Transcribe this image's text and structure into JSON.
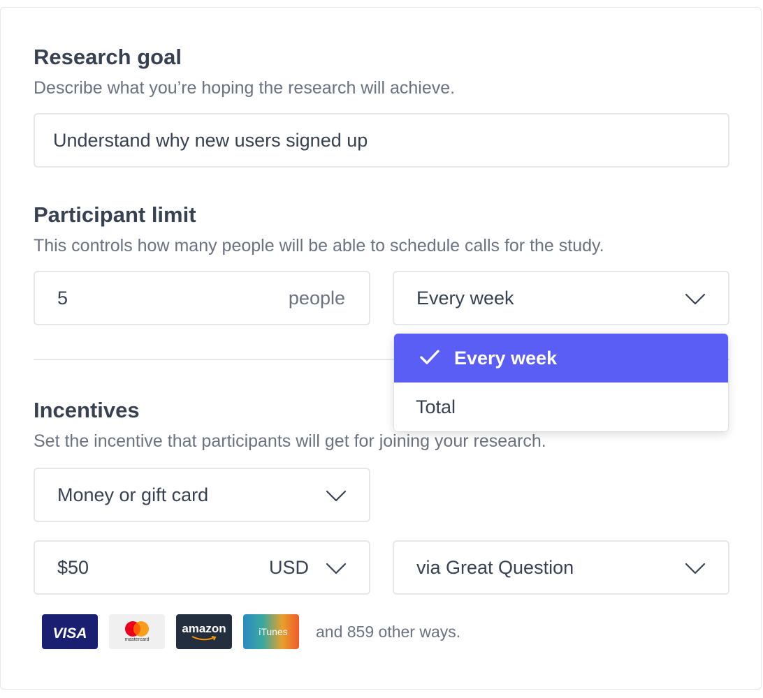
{
  "research_goal": {
    "title": "Research goal",
    "description": "Describe what you’re hoping the research will achieve.",
    "input_value": "Understand why new users signed up"
  },
  "participant_limit": {
    "title": "Participant limit",
    "description": "This controls how many people will be able to schedule calls for the study.",
    "count_value": "5",
    "count_unit": "people",
    "frequency_selected": "Every week",
    "dropdown_options": [
      {
        "label": "Every week",
        "selected": true
      },
      {
        "label": "Total",
        "selected": false
      }
    ]
  },
  "incentives": {
    "title": "Incentives",
    "description": "Set the incentive that participants will get for joining your research.",
    "type_selected": "Money or gift card",
    "amount_value": "$50",
    "currency": "USD",
    "provider_selected": "via Great Question",
    "payment_logos": [
      {
        "name": "visa",
        "text": "VISA",
        "bg": "#1a1f71"
      },
      {
        "name": "mastercard",
        "text": "mastercard",
        "bg": "#f0f0f0"
      },
      {
        "name": "amazon",
        "text": "amazon",
        "bg": "#232f3e"
      },
      {
        "name": "itunes",
        "text": "iTunes",
        "bg": "#e8602c"
      }
    ],
    "other_ways_text": "and 859 other ways."
  },
  "colors": {
    "accent": "#5b5ef4",
    "border": "#e5e7eb",
    "text": "#374151",
    "muted": "#6b7280"
  }
}
